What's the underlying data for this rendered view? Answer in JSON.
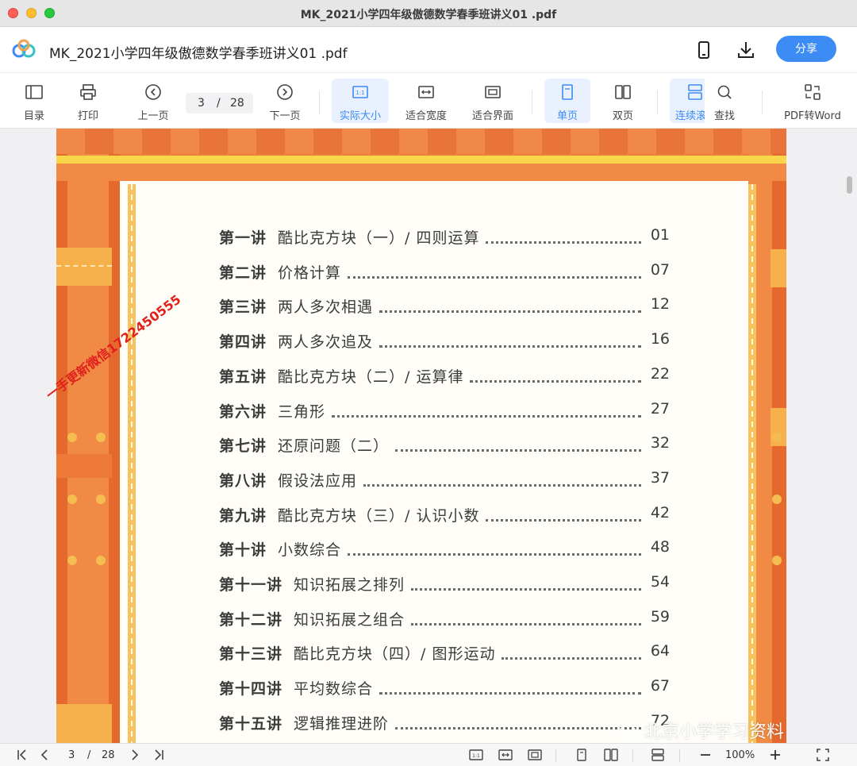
{
  "window": {
    "title": "MK_2021小学四年级傲德数学春季班讲义01 .pdf"
  },
  "header": {
    "doc_title": "MK_2021小学四年级傲德数学春季班讲义01 .pdf",
    "share_label": "分享",
    "phone_icon": "phone-icon",
    "download_icon": "download-icon",
    "logo_icon": "cloud-app-logo"
  },
  "toolbar": {
    "toc": "目录",
    "print": "打印",
    "prev": "上一页",
    "page_current": "3",
    "page_sep": "/",
    "page_total": "28",
    "next": "下一页",
    "actual_size": "实际大小",
    "fit_width": "适合宽度",
    "fit_page": "适合界面",
    "single_page": "单页",
    "double_page": "双页",
    "continuous": "连续滚",
    "find": "查找",
    "pdf_to_word": "PDF转Word",
    "active_color": "#3d8bf5"
  },
  "toc": [
    {
      "num": "第一讲",
      "title": "酷比克方块（一）/ 四则运算",
      "page": "01"
    },
    {
      "num": "第二讲",
      "title": "价格计算",
      "page": "07"
    },
    {
      "num": "第三讲",
      "title": "两人多次相遇",
      "page": "12"
    },
    {
      "num": "第四讲",
      "title": "两人多次追及",
      "page": "16"
    },
    {
      "num": "第五讲",
      "title": "酷比克方块（二）/ 运算律",
      "page": "22"
    },
    {
      "num": "第六讲",
      "title": "三角形",
      "page": "27"
    },
    {
      "num": "第七讲",
      "title": "还原问题（二）",
      "page": "32"
    },
    {
      "num": "第八讲",
      "title": "假设法应用",
      "page": "37"
    },
    {
      "num": "第九讲",
      "title": "酷比克方块（三）/ 认识小数",
      "page": "42"
    },
    {
      "num": "第十讲",
      "title": "小数综合",
      "page": "48"
    },
    {
      "num": "第十一讲",
      "title": "知识拓展之排列",
      "page": "54"
    },
    {
      "num": "第十二讲",
      "title": "知识拓展之组合",
      "page": "59"
    },
    {
      "num": "第十三讲",
      "title": "酷比克方块（四）/ 图形运动",
      "page": "64"
    },
    {
      "num": "第十四讲",
      "title": "平均数综合",
      "page": "67"
    },
    {
      "num": "第十五讲",
      "title": "逻辑推理进阶",
      "page": "72"
    }
  ],
  "watermarks": {
    "red": "一手更新微信1722450555",
    "wechat": "北京小学学习资料"
  },
  "statusbar": {
    "page_current": "3",
    "page_sep": "/",
    "page_total": "28",
    "zoom": "100%"
  },
  "colors": {
    "page_orange": "#ee7c3a",
    "page_yellow": "#f6c25d",
    "share_blue": "#3d8bf5"
  }
}
